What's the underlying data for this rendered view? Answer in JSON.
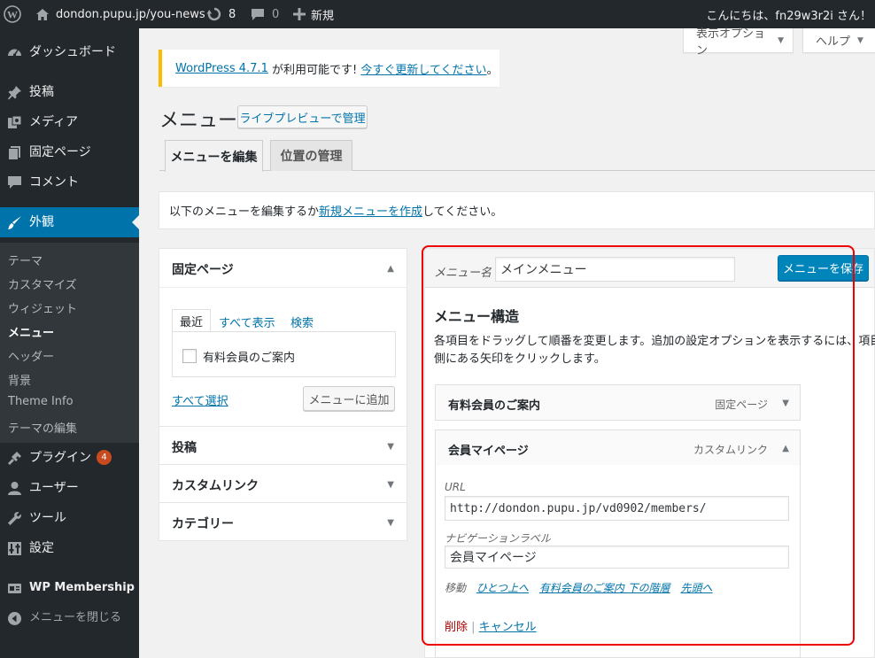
{
  "adminbar": {
    "site_name": "dondon.pupu.jp/you-news",
    "updates_count": "8",
    "comments_count": "0",
    "new_label": "新規",
    "greeting": "こんにちは、fn29w3r2i さん！"
  },
  "screen_meta": {
    "options_label": "表示オプション",
    "help_label": "ヘルプ"
  },
  "sidebar": {
    "items": [
      {
        "label": "ダッシュボード",
        "icon": "dashboard-icon"
      },
      {
        "label": "投稿",
        "icon": "pin-icon"
      },
      {
        "label": "メディア",
        "icon": "media-icon"
      },
      {
        "label": "固定ページ",
        "icon": "pages-icon"
      },
      {
        "label": "コメント",
        "icon": "comment-icon"
      },
      {
        "label": "外観",
        "icon": "brush-icon"
      },
      {
        "label": "プラグイン",
        "icon": "plugin-icon",
        "badge": "4"
      },
      {
        "label": "ユーザー",
        "icon": "user-icon"
      },
      {
        "label": "ツール",
        "icon": "wrench-icon"
      },
      {
        "label": "設定",
        "icon": "settings-icon"
      },
      {
        "label": "WP Membership",
        "icon": "membership-icon"
      },
      {
        "label": "メニューを閉じる",
        "icon": "collapse-icon"
      }
    ],
    "submenu": [
      "テーマ",
      "カスタマイズ",
      "ウィジェット",
      "メニュー",
      "ヘッダー",
      "背景",
      "Theme Info",
      "テーマの編集"
    ]
  },
  "notice": {
    "link_version": "WordPress 4.7.1",
    "text": " が利用可能です! ",
    "link_update": "今すぐ更新してください",
    "end": "。"
  },
  "header": {
    "title": "メニュー",
    "live_preview_label": "ライブプレビューで管理"
  },
  "tabs": [
    {
      "label": "メニューを編集",
      "active": true
    },
    {
      "label": "位置の管理",
      "active": false
    }
  ],
  "manage": {
    "prefix": "以下のメニューを編集するか",
    "link": "新規メニューを作成",
    "suffix": "してください。"
  },
  "left_panel": {
    "pages_title": "固定ページ",
    "sub_tabs": [
      "最近",
      "すべて表示",
      "検索"
    ],
    "page_checkbox_label": "有料会員のご案内",
    "select_all": "すべて選択",
    "add_button": "メニューに追加",
    "sections": [
      "投稿",
      "カスタムリンク",
      "カテゴリー"
    ]
  },
  "menu_editor": {
    "name_label": "メニュー名",
    "name_value": "メインメニュー",
    "save_button": "メニューを保存",
    "structure_title": "メニュー構造",
    "instructions": "各項目をドラッグして順番を変更します。追加の設定オプションを表示するには、項目の右",
    "instructions_2": "側にある矢印をクリックします。",
    "items": [
      {
        "title": "有料会員のご案内",
        "type": "固定ページ"
      },
      {
        "title": "会員マイページ",
        "type": "カスタムリンク"
      }
    ],
    "url_label": "URL",
    "url_value": "http://dondon.pupu.jp/vd0902/members/",
    "nav_label_label": "ナビゲーションラベル",
    "nav_label_value": "会員マイページ",
    "move_label": "移動",
    "move_links": [
      "ひとつ上へ",
      "有料会員のご案内 下の階層",
      "先頭へ"
    ],
    "delete_label": "削除",
    "cancel_label": "キャンセル"
  },
  "colors": {
    "admin_dark": "#23282d",
    "accent_blue": "#0073aa",
    "highlight_red": "#e00000"
  }
}
